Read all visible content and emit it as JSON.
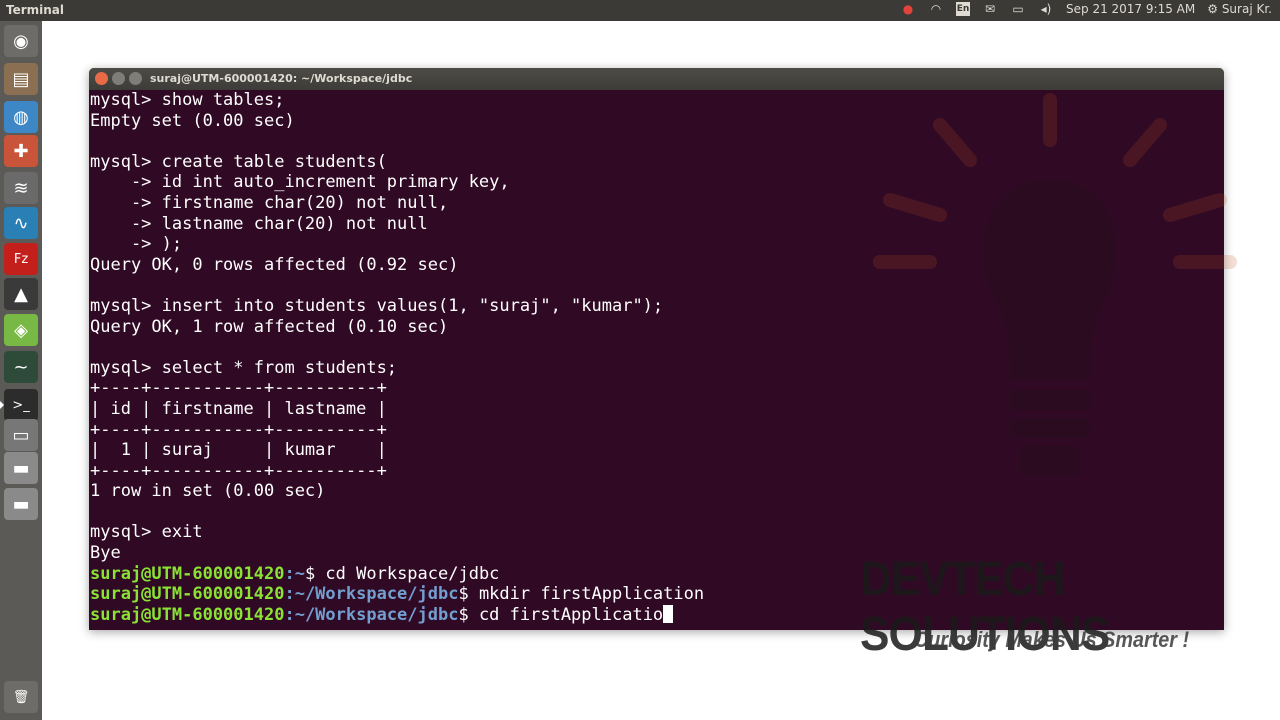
{
  "panel": {
    "app_title": "Terminal",
    "tray": {
      "record_icon": "record-icon",
      "wifi_icon": "wifi-icon",
      "keyboard_layout": "En",
      "mail_icon": "mail-icon",
      "battery_icon": "battery-icon",
      "volume_icon": "volume-icon",
      "datetime": "Sep 21 2017 9:15 AM",
      "user": "Suraj Kr."
    }
  },
  "launcher": {
    "items": [
      {
        "name": "ubuntu-dash-icon",
        "glyph": "◉",
        "color": "#6d6c68"
      },
      {
        "name": "files-icon",
        "glyph": "▤",
        "color": "#8a6f52"
      },
      {
        "name": "chromium-icon",
        "glyph": "◍",
        "color": "#3d87c7"
      },
      {
        "name": "software-tools-icon",
        "glyph": "✚",
        "color": "#c9543a"
      },
      {
        "name": "audio-icon",
        "glyph": "≋",
        "color": "#6a6a6a"
      },
      {
        "name": "system-monitor-icon",
        "glyph": "∿",
        "color": "#2a7fb5"
      },
      {
        "name": "filezilla-icon",
        "glyph": "Fz",
        "color": "#c4201b"
      },
      {
        "name": "inkscape-icon",
        "glyph": "▲",
        "color": "#3a3a3a"
      },
      {
        "name": "android-studio-icon",
        "glyph": "◈",
        "color": "#78b945"
      },
      {
        "name": "monitor-icon",
        "glyph": "~",
        "color": "#2e4b3a"
      },
      {
        "name": "terminal-icon",
        "glyph": ">_",
        "color": "#2c2c2c"
      },
      {
        "name": "drive-icon",
        "glyph": "▭",
        "color": "#777777"
      },
      {
        "name": "disk-icon-1",
        "glyph": "▬",
        "color": "#8a8a8a"
      },
      {
        "name": "disk-icon-2",
        "glyph": "▬",
        "color": "#8a8a8a"
      },
      {
        "name": "trash-icon",
        "glyph": "🗑",
        "color": "#6d6c68"
      }
    ]
  },
  "terminal": {
    "title": "suraj@UTM-600001420: ~/Workspace/jdbc",
    "lines": [
      "mysql> show tables;",
      "Empty set (0.00 sec)",
      "",
      "mysql> create table students(",
      "    -> id int auto_increment primary key,",
      "    -> firstname char(20) not null,",
      "    -> lastname char(20) not null",
      "    -> );",
      "Query OK, 0 rows affected (0.92 sec)",
      "",
      "mysql> insert into students values(1, \"suraj\", \"kumar\");",
      "Query OK, 1 row affected (0.10 sec)",
      "",
      "mysql> select * from students;",
      "+----+-----------+----------+",
      "| id | firstname | lastname |",
      "+----+-----------+----------+",
      "|  1 | suraj     | kumar    |",
      "+----+-----------+----------+",
      "1 row in set (0.00 sec)",
      "",
      "mysql> exit",
      "Bye"
    ],
    "prompts": [
      {
        "user": "suraj@UTM-600001420",
        "path": ":~",
        "command": "$ cd Workspace/jdbc"
      },
      {
        "user": "suraj@UTM-600001420",
        "path": ":~/Workspace/jdbc",
        "command": "$ mkdir firstApplication"
      },
      {
        "user": "suraj@UTM-600001420",
        "path": ":~/Workspace/jdbc",
        "command": "$ cd firstApplicatio"
      }
    ]
  },
  "watermark": {
    "brand": "DEVTECH SOLUTIONS",
    "tagline": "Curiosity Makes Us Smarter !"
  }
}
